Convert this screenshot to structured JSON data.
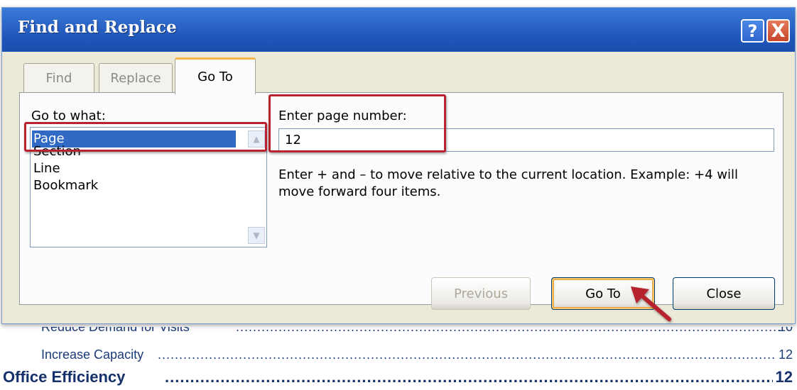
{
  "dialog": {
    "title": "Find and Replace",
    "help_glyph": "?",
    "close_glyph": "X"
  },
  "tabs": [
    {
      "label": "Find",
      "active": false
    },
    {
      "label": "Replace",
      "active": false
    },
    {
      "label": "Go To",
      "active": true
    }
  ],
  "goto": {
    "go_to_what_label": "Go to what:",
    "items": [
      "Page",
      "Section",
      "Line",
      "Bookmark"
    ],
    "selected": "Page",
    "enter_label": "Enter page number:",
    "page_value": "12",
    "help_text": "Enter + and – to move relative to the current location. Example: +4 will move forward four items."
  },
  "buttons": {
    "previous": "Previous",
    "goto": "Go To",
    "close": "Close"
  },
  "document": {
    "toc": [
      {
        "text": "Reduce Demand for Visits",
        "page": "10",
        "level": 2
      },
      {
        "text": "Increase Capacity",
        "page": "12",
        "level": 2
      },
      {
        "text": "Office Efficiency",
        "page": "12",
        "level": 1
      }
    ]
  },
  "colors": {
    "title_bar": "#2d68c9",
    "selection": "#316ac5",
    "highlight_box": "#b8232f"
  }
}
